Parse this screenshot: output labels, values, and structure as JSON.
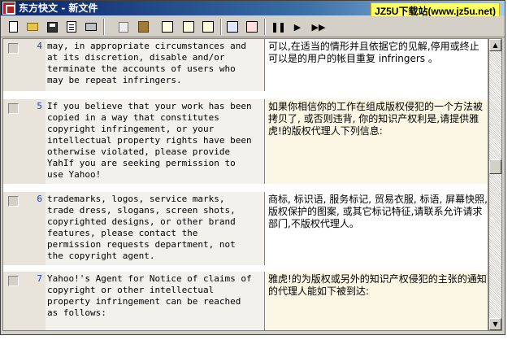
{
  "window": {
    "app_name": "东方快文",
    "title_separator": " - ",
    "doc_name": "新文件"
  },
  "watermark": "JZ5U下载站(www.jz5u.net)",
  "toolbar": {
    "buttons": [
      "new-doc-icon",
      "open-folder-icon",
      "save-disk-icon",
      "preview-doc-icon",
      "print-icon",
      "copy-icon",
      "paste-icon",
      "panel-left-icon",
      "panel-center-icon",
      "panel-right-icon",
      "cursor-edit-icon",
      "pen-edit-icon",
      "pause-icon",
      "play-icon",
      "fast-forward-icon"
    ],
    "pause_glyph": "❚❚",
    "play_glyph": "▶",
    "ff_glyph": "▶▶"
  },
  "rows": [
    {
      "num": "4",
      "source": "may, in appropriate circumstances and\nat its discretion, disable and/or\nterminate the accounts of users who\nmay be repeat infringers.",
      "target": "可以,在适当的情形并且依据它的见解,停用或终止可以是的用户的帐目重复\ninfringers 。"
    },
    {
      "num": "5",
      "source": "If you believe that your work has been\ncopied in a way that constitutes\ncopyright infringement, or your\nintellectual property rights have been\notherwise violated, please provide\nYahIf you are seeking permission to\nuse Yahoo!",
      "target": "如果你相信你的工作在组成版权侵犯的一个方法被拷贝了, 或否则违背, 你的知识产权利是,请提供雅虎!的版权代理人下列信息:"
    },
    {
      "num": "6",
      "source": "trademarks, logos, service marks,\ntrade dress, slogans, screen shots,\ncopyrighted designs, or other brand\nfeatures, please contact the\npermission requests department, not\nthe copyright agent.",
      "target": "商标, 标识语, 服务标记, 贸易衣服, 标语, 屏幕快照, 版权保护的图案, 或其它标记特征,请联系允许请求部门,不版权代理人。"
    },
    {
      "num": "7",
      "source": "Yahoo!'s Agent for Notice of claims of\ncopyright or other intellectual\nproperty infringement can be reached\nas follows:",
      "target": "雅虎!的为版权或另外的知识产权侵犯的主张的通知的代理人能如下被到达:"
    }
  ]
}
